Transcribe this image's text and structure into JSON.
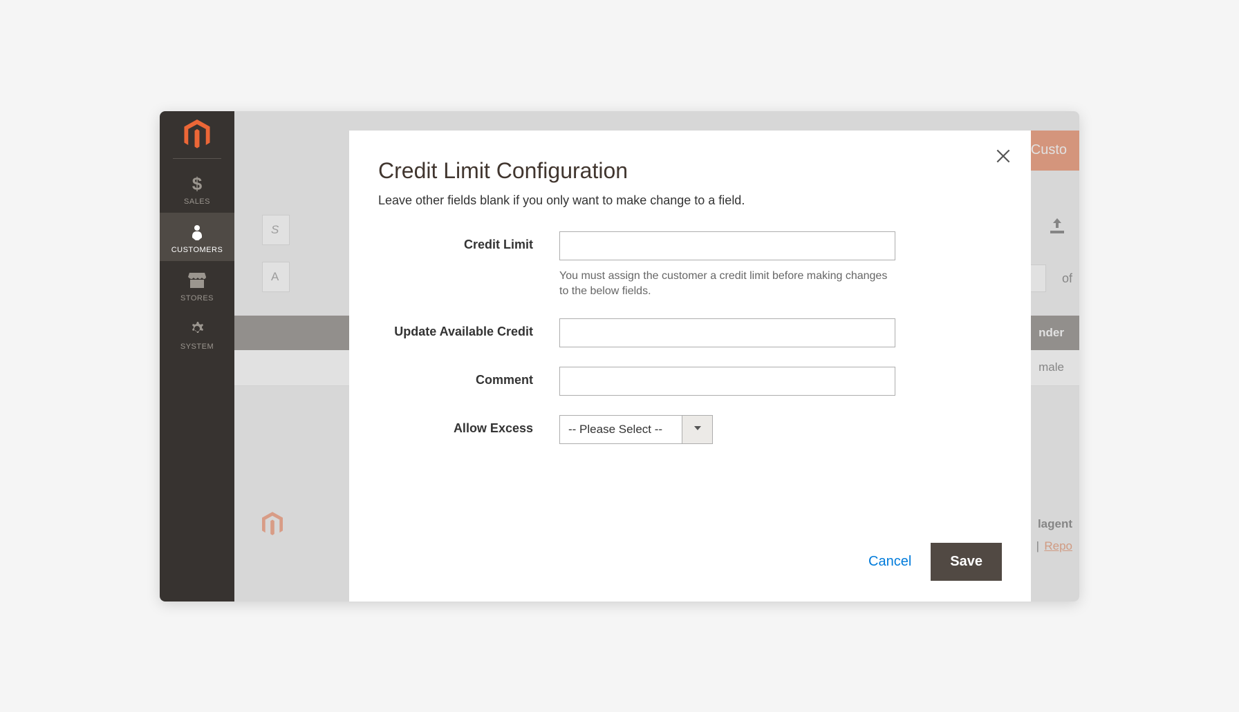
{
  "sidebar": {
    "items": [
      {
        "label": "SALES",
        "icon": "dollar-icon"
      },
      {
        "label": "CUSTOMERS",
        "icon": "person-icon"
      },
      {
        "label": "STORES",
        "icon": "store-icon"
      },
      {
        "label": "SYSTEM",
        "icon": "gear-icon"
      }
    ],
    "active_index": 1
  },
  "background": {
    "top_button_partial": "Custo",
    "of_label": "of",
    "table_header_partial": "nder",
    "table_cell_partial": "male",
    "footer_brand_partial": "lagent",
    "footer_link_partial": "Repo",
    "footer_divider": "|",
    "searchbox1_partial": "S",
    "searchbox2_partial": "A"
  },
  "modal": {
    "title": "Credit Limit Configuration",
    "subtitle": "Leave other fields blank if you only want to make change to a field.",
    "fields": {
      "credit_limit": {
        "label": "Credit Limit",
        "value": "",
        "hint": "You must assign the customer a credit limit before making changes to the below fields."
      },
      "update_available_credit": {
        "label": "Update Available Credit",
        "value": ""
      },
      "comment": {
        "label": "Comment",
        "value": ""
      },
      "allow_excess": {
        "label": "Allow Excess",
        "selected": "-- Please Select --"
      }
    },
    "buttons": {
      "cancel": "Cancel",
      "save": "Save"
    }
  }
}
